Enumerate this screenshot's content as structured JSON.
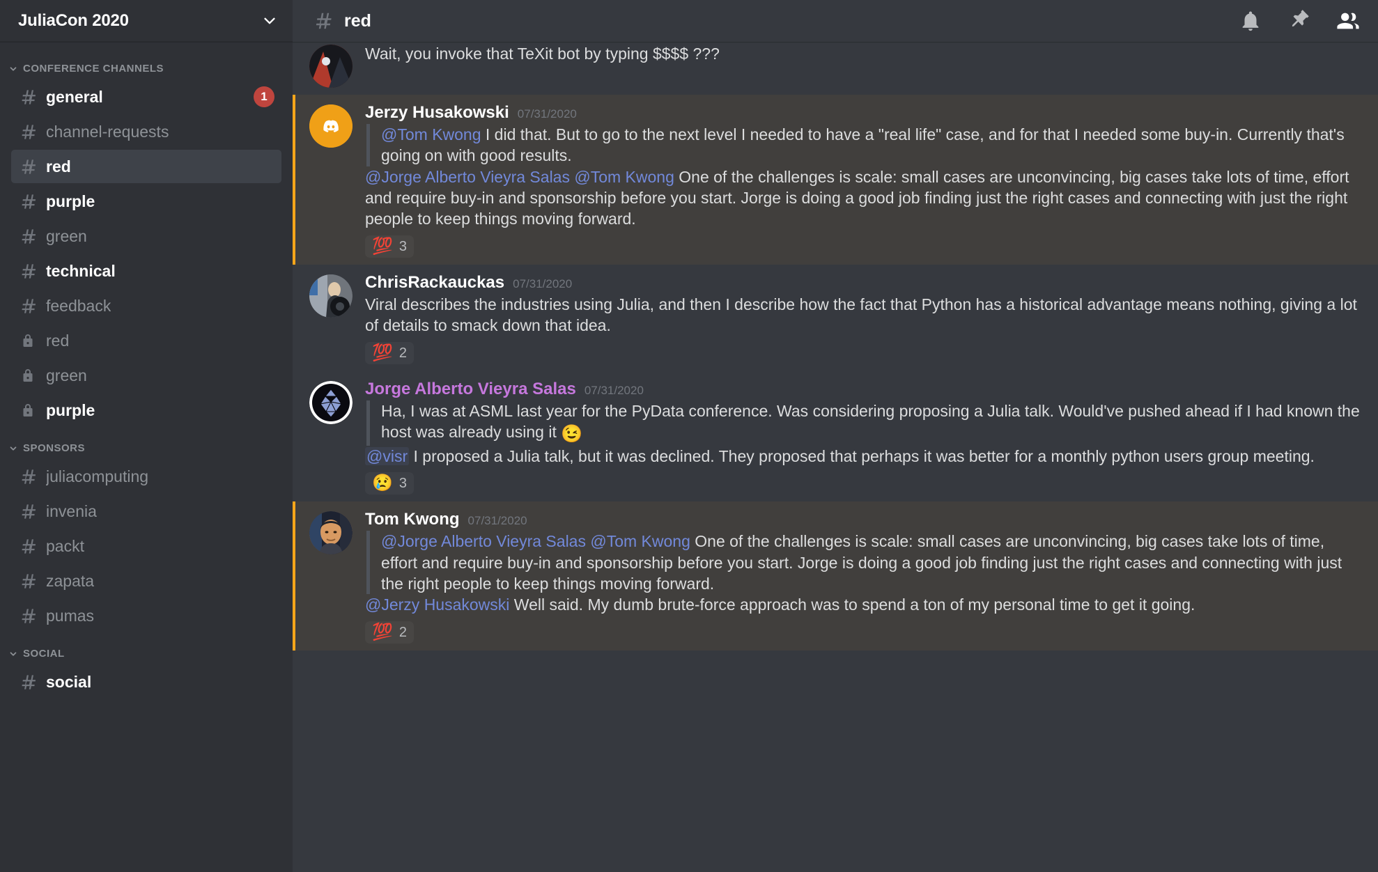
{
  "sidebar": {
    "server_name": "JuliaCon 2020",
    "dropdown_icon": "chevron-down-icon",
    "categories": [
      {
        "label": "CONFERENCE CHANNELS",
        "channels": [
          {
            "name": "general",
            "icon": "hash",
            "state": "unread",
            "badge": "1"
          },
          {
            "name": "channel-requests",
            "icon": "hash",
            "state": "read",
            "badge": ""
          },
          {
            "name": "red",
            "icon": "hash",
            "state": "active",
            "badge": ""
          },
          {
            "name": "purple",
            "icon": "hash",
            "state": "unread",
            "badge": ""
          },
          {
            "name": "green",
            "icon": "hash",
            "state": "read",
            "badge": ""
          },
          {
            "name": "technical",
            "icon": "hash",
            "state": "unread",
            "badge": ""
          },
          {
            "name": "feedback",
            "icon": "hash",
            "state": "read",
            "badge": ""
          },
          {
            "name": "red",
            "icon": "lock",
            "state": "read",
            "badge": ""
          },
          {
            "name": "green",
            "icon": "lock",
            "state": "read",
            "badge": ""
          },
          {
            "name": "purple",
            "icon": "lock",
            "state": "unread",
            "badge": ""
          }
        ]
      },
      {
        "label": "SPONSORS",
        "channels": [
          {
            "name": "juliacomputing",
            "icon": "hash",
            "state": "read",
            "badge": ""
          },
          {
            "name": "invenia",
            "icon": "hash",
            "state": "read",
            "badge": ""
          },
          {
            "name": "packt",
            "icon": "hash",
            "state": "read",
            "badge": ""
          },
          {
            "name": "zapata",
            "icon": "hash",
            "state": "read",
            "badge": ""
          },
          {
            "name": "pumas",
            "icon": "hash",
            "state": "read",
            "badge": ""
          }
        ]
      },
      {
        "label": "SOCIAL",
        "channels": [
          {
            "name": "social",
            "icon": "hash",
            "state": "unread",
            "badge": ""
          }
        ]
      }
    ]
  },
  "header": {
    "hash": "#",
    "channel_title": "red",
    "icons": [
      {
        "name": "notifications-bell-icon"
      },
      {
        "name": "pinned-messages-icon"
      },
      {
        "name": "member-list-icon"
      }
    ]
  },
  "messages": [
    {
      "id": "m0",
      "partial": true,
      "mention": false,
      "author": "",
      "time": "",
      "avatar": "av-top",
      "lines": [
        {
          "quote": false,
          "parts": [
            {
              "type": "text",
              "text": "Wait, you invoke that TeXit bot by typing $$$$ ???"
            }
          ]
        }
      ],
      "reactions": []
    },
    {
      "id": "m1",
      "partial": false,
      "mention": true,
      "author": "Jerzy Husakowski",
      "author_color": "white",
      "time": "07/31/2020",
      "avatar": "av-discord",
      "lines": [
        {
          "quote": true,
          "parts": [
            {
              "type": "mention",
              "text": "@Tom Kwong"
            },
            {
              "type": "text",
              "text": " I did that. But to go to the next level I needed to have a \"real life\" case, and for that I needed some buy-in. Currently that's going on with good results."
            }
          ]
        },
        {
          "quote": false,
          "parts": [
            {
              "type": "mention",
              "text": "@Jorge Alberto Vieyra Salas"
            },
            {
              "type": "text",
              "text": " "
            },
            {
              "type": "mention",
              "text": "@Tom Kwong"
            },
            {
              "type": "text",
              "text": " One of the challenges is scale: small cases are unconvincing, big cases take lots of time, effort and require buy-in and sponsorship before you start. Jorge is doing a good job finding just the right cases and connecting with just the right people to keep things moving forward."
            }
          ]
        }
      ],
      "reactions": [
        {
          "emoji": "💯",
          "count": "3"
        }
      ]
    },
    {
      "id": "m2",
      "partial": false,
      "mention": false,
      "author": "ChrisRackauckas",
      "author_color": "white",
      "time": "07/31/2020",
      "avatar": "av-chris",
      "lines": [
        {
          "quote": false,
          "parts": [
            {
              "type": "text",
              "text": "Viral describes the industries using Julia, and then I describe how the fact that Python has a historical advantage means nothing, giving a lot of details to smack down that idea."
            }
          ]
        }
      ],
      "reactions": [
        {
          "emoji": "💯",
          "count": "2"
        }
      ]
    },
    {
      "id": "m3",
      "partial": false,
      "mention": false,
      "author": "Jorge Alberto Vieyra Salas",
      "author_color": "purple",
      "time": "07/31/2020",
      "avatar": "av-jorge",
      "lines": [
        {
          "quote": true,
          "parts": [
            {
              "type": "text",
              "text": "Ha, I was at ASML last year for the PyData conference. Was considering proposing a Julia talk. Would've pushed ahead if I had known the host was already using it "
            },
            {
              "type": "emoji",
              "text": "😉"
            }
          ]
        },
        {
          "quote": false,
          "parts": [
            {
              "type": "mention-pill",
              "text": "@visr"
            },
            {
              "type": "text",
              "text": " I proposed a Julia talk, but it was declined. They proposed that perhaps it was better for a monthly python users group meeting."
            }
          ]
        }
      ],
      "reactions": [
        {
          "emoji": "😢",
          "count": "3"
        }
      ]
    },
    {
      "id": "m4",
      "partial": false,
      "mention": true,
      "author": "Tom Kwong",
      "author_color": "white",
      "time": "07/31/2020",
      "avatar": "av-tom",
      "lines": [
        {
          "quote": true,
          "parts": [
            {
              "type": "mention",
              "text": "@Jorge Alberto Vieyra Salas"
            },
            {
              "type": "text",
              "text": " "
            },
            {
              "type": "mention",
              "text": "@Tom Kwong"
            },
            {
              "type": "text",
              "text": " One of the challenges is scale: small cases are unconvincing, big cases take lots of time, effort and require buy-in and sponsorship before you start. Jorge is doing a good job finding just the right cases and connecting with just the right people to keep things moving forward."
            }
          ]
        },
        {
          "quote": false,
          "parts": [
            {
              "type": "mention",
              "text": "@Jerzy Husakowski"
            },
            {
              "type": "text",
              "text": " Well said.  My dumb brute-force approach was to spend a ton of my personal time to get it going."
            }
          ]
        }
      ],
      "reactions": [
        {
          "emoji": "💯",
          "count": "2"
        }
      ]
    }
  ]
}
